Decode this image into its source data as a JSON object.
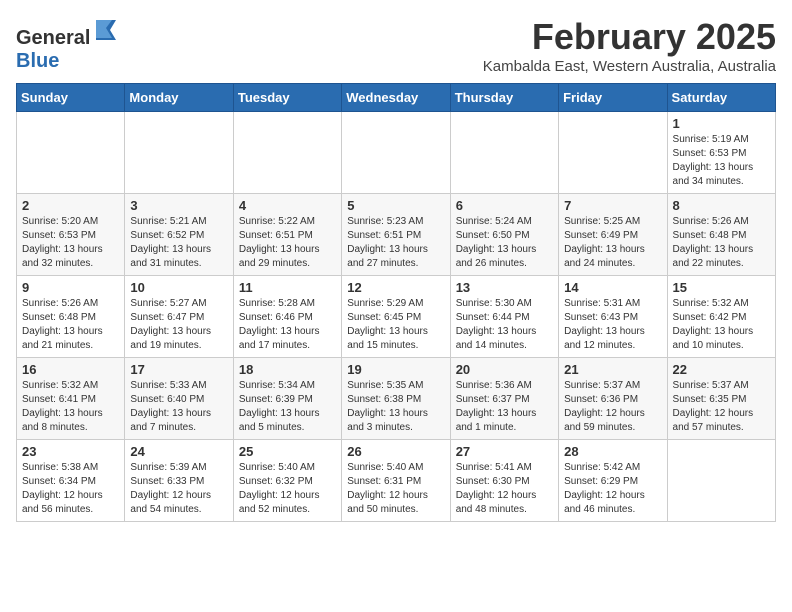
{
  "logo": {
    "general": "General",
    "blue": "Blue"
  },
  "header": {
    "month": "February 2025",
    "location": "Kambalda East, Western Australia, Australia"
  },
  "days_of_week": [
    "Sunday",
    "Monday",
    "Tuesday",
    "Wednesday",
    "Thursday",
    "Friday",
    "Saturday"
  ],
  "weeks": [
    [
      {
        "day": "",
        "info": ""
      },
      {
        "day": "",
        "info": ""
      },
      {
        "day": "",
        "info": ""
      },
      {
        "day": "",
        "info": ""
      },
      {
        "day": "",
        "info": ""
      },
      {
        "day": "",
        "info": ""
      },
      {
        "day": "1",
        "info": "Sunrise: 5:19 AM\nSunset: 6:53 PM\nDaylight: 13 hours\nand 34 minutes."
      }
    ],
    [
      {
        "day": "2",
        "info": "Sunrise: 5:20 AM\nSunset: 6:53 PM\nDaylight: 13 hours\nand 32 minutes."
      },
      {
        "day": "3",
        "info": "Sunrise: 5:21 AM\nSunset: 6:52 PM\nDaylight: 13 hours\nand 31 minutes."
      },
      {
        "day": "4",
        "info": "Sunrise: 5:22 AM\nSunset: 6:51 PM\nDaylight: 13 hours\nand 29 minutes."
      },
      {
        "day": "5",
        "info": "Sunrise: 5:23 AM\nSunset: 6:51 PM\nDaylight: 13 hours\nand 27 minutes."
      },
      {
        "day": "6",
        "info": "Sunrise: 5:24 AM\nSunset: 6:50 PM\nDaylight: 13 hours\nand 26 minutes."
      },
      {
        "day": "7",
        "info": "Sunrise: 5:25 AM\nSunset: 6:49 PM\nDaylight: 13 hours\nand 24 minutes."
      },
      {
        "day": "8",
        "info": "Sunrise: 5:26 AM\nSunset: 6:48 PM\nDaylight: 13 hours\nand 22 minutes."
      }
    ],
    [
      {
        "day": "9",
        "info": "Sunrise: 5:26 AM\nSunset: 6:48 PM\nDaylight: 13 hours\nand 21 minutes."
      },
      {
        "day": "10",
        "info": "Sunrise: 5:27 AM\nSunset: 6:47 PM\nDaylight: 13 hours\nand 19 minutes."
      },
      {
        "day": "11",
        "info": "Sunrise: 5:28 AM\nSunset: 6:46 PM\nDaylight: 13 hours\nand 17 minutes."
      },
      {
        "day": "12",
        "info": "Sunrise: 5:29 AM\nSunset: 6:45 PM\nDaylight: 13 hours\nand 15 minutes."
      },
      {
        "day": "13",
        "info": "Sunrise: 5:30 AM\nSunset: 6:44 PM\nDaylight: 13 hours\nand 14 minutes."
      },
      {
        "day": "14",
        "info": "Sunrise: 5:31 AM\nSunset: 6:43 PM\nDaylight: 13 hours\nand 12 minutes."
      },
      {
        "day": "15",
        "info": "Sunrise: 5:32 AM\nSunset: 6:42 PM\nDaylight: 13 hours\nand 10 minutes."
      }
    ],
    [
      {
        "day": "16",
        "info": "Sunrise: 5:32 AM\nSunset: 6:41 PM\nDaylight: 13 hours\nand 8 minutes."
      },
      {
        "day": "17",
        "info": "Sunrise: 5:33 AM\nSunset: 6:40 PM\nDaylight: 13 hours\nand 7 minutes."
      },
      {
        "day": "18",
        "info": "Sunrise: 5:34 AM\nSunset: 6:39 PM\nDaylight: 13 hours\nand 5 minutes."
      },
      {
        "day": "19",
        "info": "Sunrise: 5:35 AM\nSunset: 6:38 PM\nDaylight: 13 hours\nand 3 minutes."
      },
      {
        "day": "20",
        "info": "Sunrise: 5:36 AM\nSunset: 6:37 PM\nDaylight: 13 hours\nand 1 minute."
      },
      {
        "day": "21",
        "info": "Sunrise: 5:37 AM\nSunset: 6:36 PM\nDaylight: 12 hours\nand 59 minutes."
      },
      {
        "day": "22",
        "info": "Sunrise: 5:37 AM\nSunset: 6:35 PM\nDaylight: 12 hours\nand 57 minutes."
      }
    ],
    [
      {
        "day": "23",
        "info": "Sunrise: 5:38 AM\nSunset: 6:34 PM\nDaylight: 12 hours\nand 56 minutes."
      },
      {
        "day": "24",
        "info": "Sunrise: 5:39 AM\nSunset: 6:33 PM\nDaylight: 12 hours\nand 54 minutes."
      },
      {
        "day": "25",
        "info": "Sunrise: 5:40 AM\nSunset: 6:32 PM\nDaylight: 12 hours\nand 52 minutes."
      },
      {
        "day": "26",
        "info": "Sunrise: 5:40 AM\nSunset: 6:31 PM\nDaylight: 12 hours\nand 50 minutes."
      },
      {
        "day": "27",
        "info": "Sunrise: 5:41 AM\nSunset: 6:30 PM\nDaylight: 12 hours\nand 48 minutes."
      },
      {
        "day": "28",
        "info": "Sunrise: 5:42 AM\nSunset: 6:29 PM\nDaylight: 12 hours\nand 46 minutes."
      },
      {
        "day": "",
        "info": ""
      }
    ]
  ]
}
